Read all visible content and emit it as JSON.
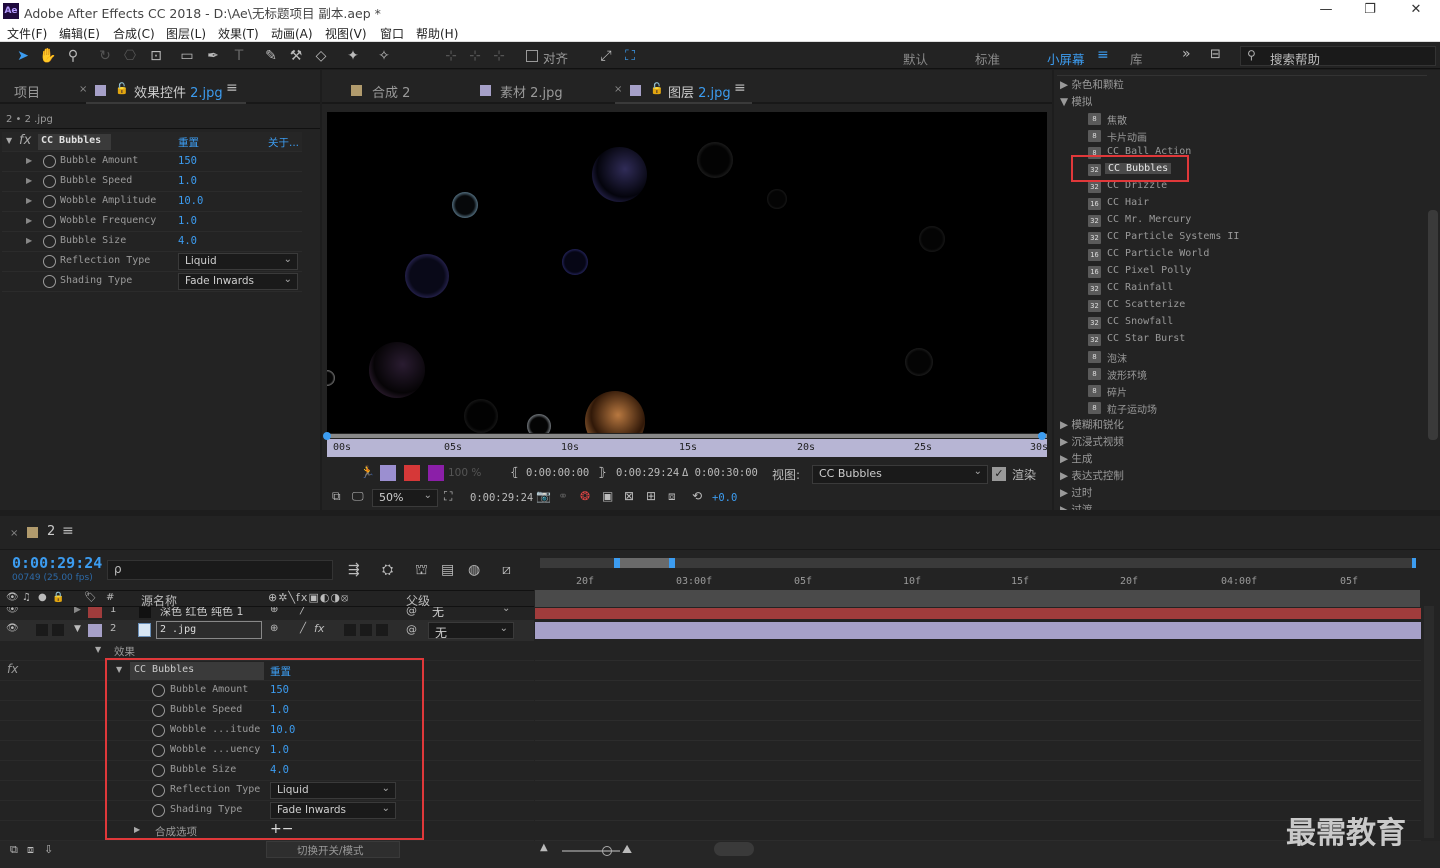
{
  "app": {
    "title": "Adobe After Effects CC 2018 - D:\\Ae\\无标题项目 副本.aep *",
    "logo": "Ae"
  },
  "menu": [
    "文件(F)",
    "编辑(E)",
    "合成(C)",
    "图层(L)",
    "效果(T)",
    "动画(A)",
    "视图(V)",
    "窗口",
    "帮助(H)"
  ],
  "toolbar": {
    "snap_label": "对齐",
    "workspaces": [
      "默认",
      "标准",
      "小屏幕",
      "库"
    ],
    "active_workspace": "小屏幕",
    "search_placeholder": "搜索帮助"
  },
  "left_panel": {
    "tab_project": "项目",
    "tab_effects_prefix": "效果控件",
    "tab_effects_layer": "2.jpg",
    "breadcrumb": "2 • 2 .jpg",
    "effect_name": "CC Bubbles",
    "reset": "重置",
    "about": "关于...",
    "properties": [
      {
        "name": "Bubble Amount",
        "value": "150"
      },
      {
        "name": "Bubble Speed",
        "value": "1.0"
      },
      {
        "name": "Wobble Amplitude",
        "value": "10.0"
      },
      {
        "name": "Wobble Frequency",
        "value": "1.0"
      },
      {
        "name": "Bubble Size",
        "value": "4.0"
      }
    ],
    "dropdowns": [
      {
        "name": "Reflection Type",
        "value": "Liquid"
      },
      {
        "name": "Shading Type",
        "value": "Fade Inwards"
      }
    ]
  },
  "viewer": {
    "tabs": [
      {
        "label": "合成 2"
      },
      {
        "label": "素材 2.jpg"
      },
      {
        "label": "图层 2.jpg"
      }
    ],
    "active_tab_prefix": "图层",
    "active_tab_layer": "2.jpg",
    "ruler": [
      "00s",
      "05s",
      "10s",
      "15s",
      "20s",
      "25s",
      "30s"
    ],
    "opacity": "100 %",
    "in_time": "0:00:00:00",
    "out_time": "0:00:29:24",
    "duration": "Δ 0:00:30:00",
    "view_label": "视图:",
    "view_value": "CC Bubbles",
    "render_label": "渲染",
    "zoom": "50%",
    "current_time": "0:00:29:24",
    "exposure": "+0.0"
  },
  "effects_panel": {
    "categories_top": [
      "杂色和颗粒",
      "模拟"
    ],
    "items": [
      {
        "icon": "8",
        "label": "焦散"
      },
      {
        "icon": "8",
        "label": "卡片动画"
      },
      {
        "icon": "8",
        "label": "CC Ball Action"
      },
      {
        "icon": "32",
        "label": "CC Bubbles"
      },
      {
        "icon": "32",
        "label": "CC Drizzle"
      },
      {
        "icon": "16",
        "label": "CC Hair"
      },
      {
        "icon": "32",
        "label": "CC Mr. Mercury"
      },
      {
        "icon": "32",
        "label": "CC Particle Systems II"
      },
      {
        "icon": "16",
        "label": "CC Particle World"
      },
      {
        "icon": "16",
        "label": "CC Pixel Polly"
      },
      {
        "icon": "32",
        "label": "CC Rainfall"
      },
      {
        "icon": "32",
        "label": "CC Scatterize"
      },
      {
        "icon": "32",
        "label": "CC Snowfall"
      },
      {
        "icon": "32",
        "label": "CC Star Burst"
      },
      {
        "icon": "8",
        "label": "泡沫"
      },
      {
        "icon": "8",
        "label": "波形环境"
      },
      {
        "icon": "8",
        "label": "碎片"
      },
      {
        "icon": "8",
        "label": "粒子运动场"
      }
    ],
    "categories_bottom": [
      "模糊和锐化",
      "沉浸式视频",
      "生成",
      "表达式控制",
      "过时",
      "过渡"
    ],
    "highlighted": "CC Bubbles"
  },
  "timeline": {
    "comp_tab": "2",
    "timecode": "0:00:29:24",
    "fps_info": "00749 (25.00 fps)",
    "search_placeholder": "ρ",
    "col_source": "源名称",
    "col_parent": "父级",
    "layers": [
      {
        "num": "1",
        "name": "深色 红色 纯色 1",
        "parent": "无"
      },
      {
        "num": "2",
        "name": "2 .jpg",
        "parent": "无"
      }
    ],
    "effects_group": "效果",
    "effect_name": "CC Bubbles",
    "reset": "重置",
    "properties": [
      {
        "name": "Bubble Amount",
        "value": "150"
      },
      {
        "name": "Bubble Speed",
        "value": "1.0"
      },
      {
        "name": "Wobble ...itude",
        "value": "10.0"
      },
      {
        "name": "Wobble ...uency",
        "value": "1.0"
      },
      {
        "name": "Bubble Size",
        "value": "4.0"
      }
    ],
    "dropdowns": [
      {
        "name": "Reflection Type",
        "value": "Liquid"
      },
      {
        "name": "Shading Type",
        "value": "Fade Inwards"
      }
    ],
    "composite_options": "合成选项",
    "ruler_ticks": [
      "20f",
      "03:00f",
      "05f",
      "10f",
      "15f",
      "20f",
      "04:00f",
      "05f"
    ],
    "toggle_label": "切换开关/模式"
  },
  "watermark": "最需教育",
  "colors": {
    "accent": "#3c9cf0",
    "highlight": "#e0383a",
    "layer1": "#a03c3c",
    "layer2": "#a6a0c8"
  }
}
